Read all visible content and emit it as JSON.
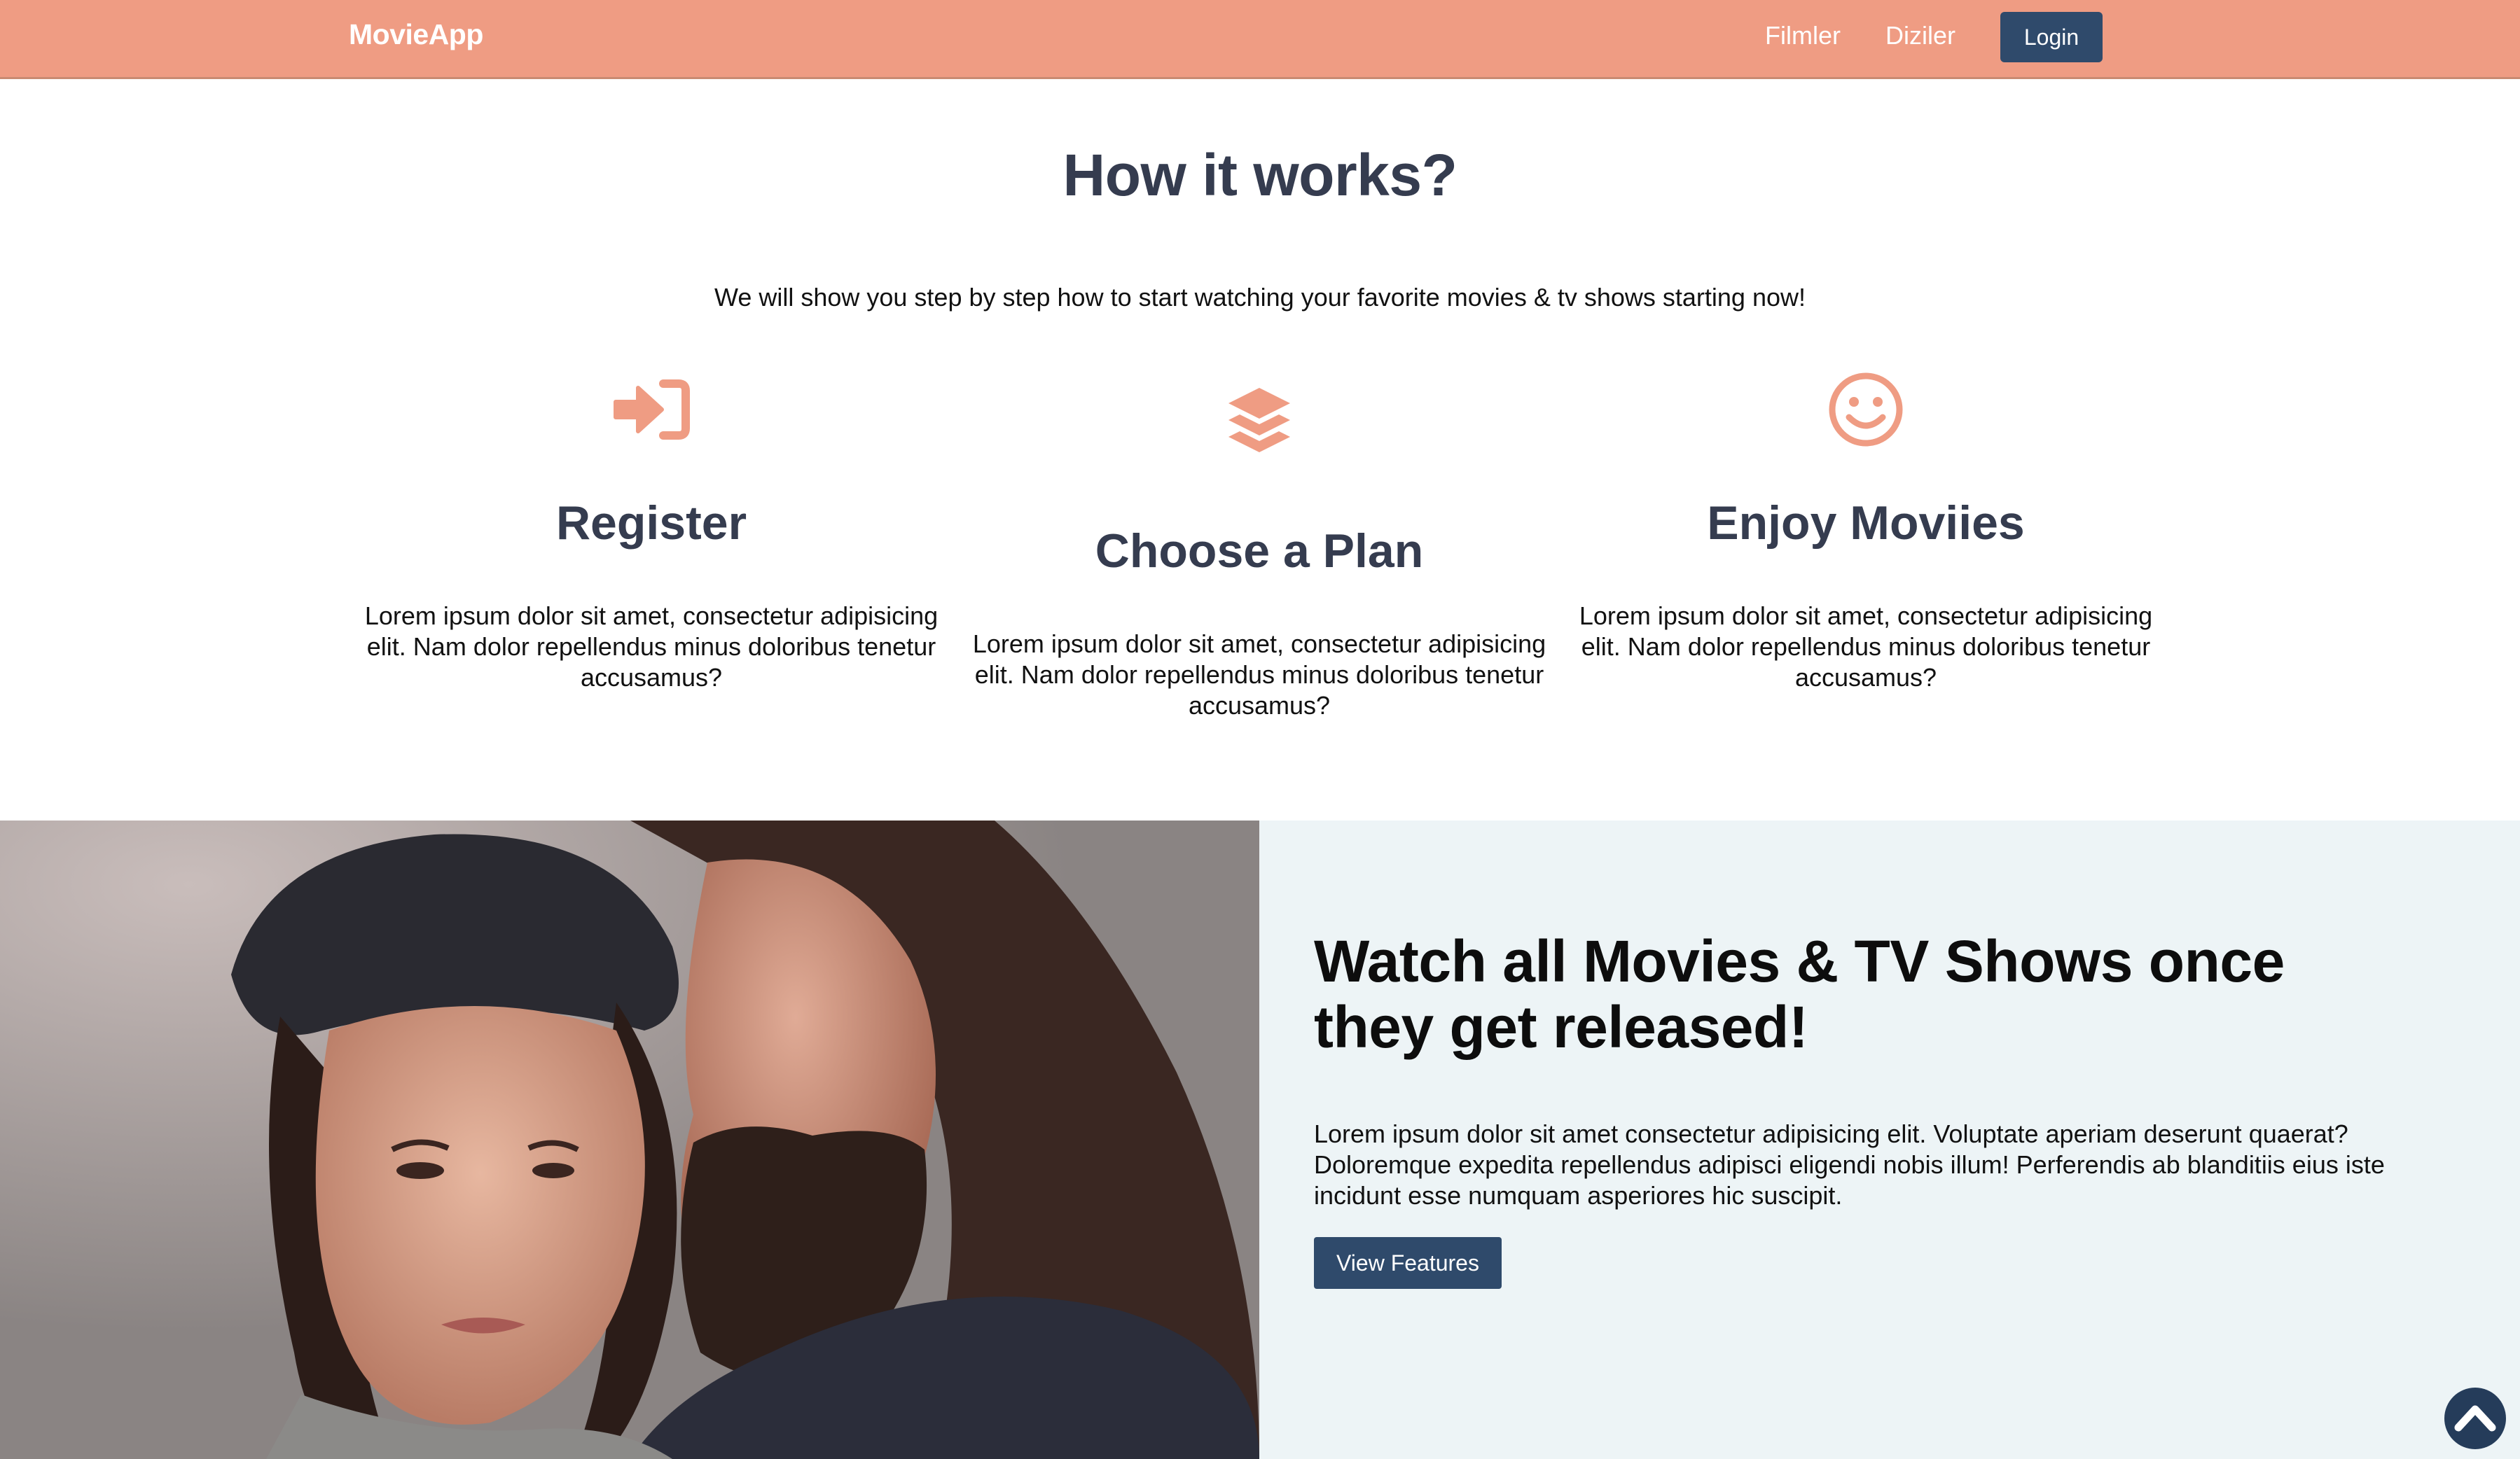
{
  "colors": {
    "accent": "#ef9c83",
    "primary_button": "#2f4a6b",
    "heading": "#353c4f",
    "panel_bg": "#edf4f6"
  },
  "navbar": {
    "brand": "MovieApp",
    "links": [
      "Filmler",
      "Diziler"
    ],
    "login_label": "Login"
  },
  "how_it_works": {
    "title": "How it works?",
    "subtitle": "We will show you step by step how to start watching your favorite movies & tv shows starting now!",
    "steps": [
      {
        "icon": "sign-in-icon",
        "title": "Register",
        "text": "Lorem ipsum dolor sit amet, consectetur adipisicing elit. Nam dolor repellendus minus doloribus tenetur accusamus?"
      },
      {
        "icon": "layers-icon",
        "title": "Choose a Plan",
        "text": "Lorem ipsum dolor sit amet, consectetur adipisicing elit. Nam dolor repellendus minus doloribus tenetur accusamus?"
      },
      {
        "icon": "smile-icon",
        "title": "Enjoy Moviies",
        "text": "Lorem ipsum dolor sit amet, consectetur adipisicing elit. Nam dolor repellendus minus doloribus tenetur accusamus?"
      }
    ]
  },
  "watch_section": {
    "title": "Watch all Movies & TV Shows once they get released!",
    "text": "Lorem ipsum dolor sit amet consectetur adipisicing elit. Voluptate aperiam deserunt quaerat? Doloremque expedita repellendus adipisci eligendi nobis illum! Perferendis ab blanditiis eius iste incidunt esse numquam asperiores hic suscipit.",
    "button_label": "View Features",
    "photo_icon": "couple-photo"
  },
  "scroll_top_icon": "chevron-up-icon"
}
